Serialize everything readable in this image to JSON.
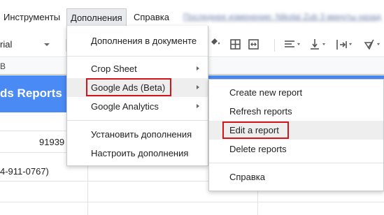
{
  "menubar": {
    "tools": "Инструменты",
    "addons": "Дополнения",
    "help": "Справка",
    "last_edit": "Последнее изменение: Nikolai Zub 3 минуты назад"
  },
  "toolbar": {
    "font": "rial"
  },
  "sheet": {
    "col_header": "B",
    "report_title": "ds Reports",
    "number": "91939",
    "phone": "4-911-0767)",
    "header_color": "#4a8af4"
  },
  "addons_menu": {
    "docs_addons": "Дополнения в документе",
    "crop_sheet": "Crop Sheet",
    "google_ads": "Google Ads (Beta)",
    "google_analytics": "Google Analytics",
    "install": "Установить дополнения",
    "manage": "Настроить дополнения"
  },
  "report_menu": {
    "create": "Create new report",
    "refresh": "Refresh reports",
    "edit": "Edit a report",
    "delete": "Delete reports",
    "help": "Справка"
  },
  "highlight_color": "#d2151b"
}
